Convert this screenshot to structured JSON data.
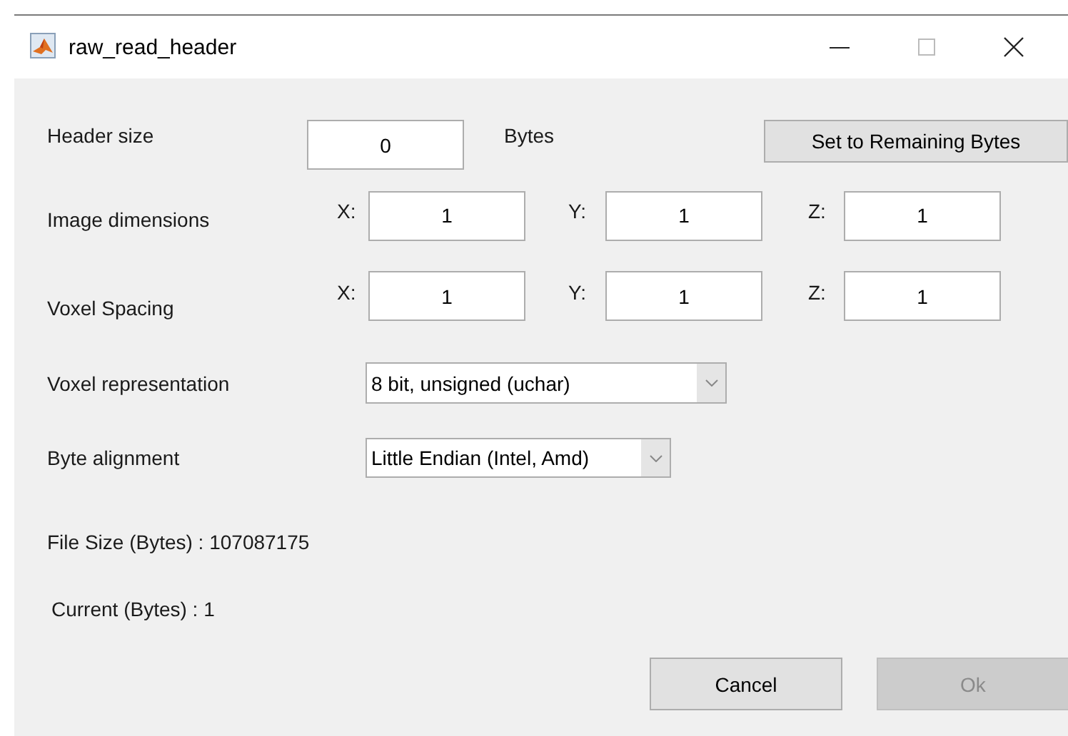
{
  "window": {
    "title": "raw_read_header"
  },
  "header_size": {
    "label": "Header size",
    "value": "0",
    "unit": "Bytes",
    "button": "Set to Remaining Bytes"
  },
  "image_dimensions": {
    "label": "Image dimensions",
    "fields": [
      {
        "axis": "X:",
        "value": "1"
      },
      {
        "axis": "Y:",
        "value": "1"
      },
      {
        "axis": "Z:",
        "value": "1"
      }
    ]
  },
  "voxel_spacing": {
    "label": "Voxel Spacing",
    "fields": [
      {
        "axis": "X:",
        "value": "1"
      },
      {
        "axis": "Y:",
        "value": "1"
      },
      {
        "axis": "Z:",
        "value": "1"
      }
    ]
  },
  "voxel_representation": {
    "label": "Voxel representation",
    "value": "8 bit, unsigned (uchar)"
  },
  "byte_alignment": {
    "label": "Byte alignment",
    "value": "Little Endian (Intel, Amd)"
  },
  "file_size": "File Size (Bytes) : 107087175",
  "current": "Current (Bytes) : 1",
  "buttons": [
    {
      "label": "Cancel",
      "disabled": false
    },
    {
      "label": "Ok",
      "disabled": true
    }
  ]
}
